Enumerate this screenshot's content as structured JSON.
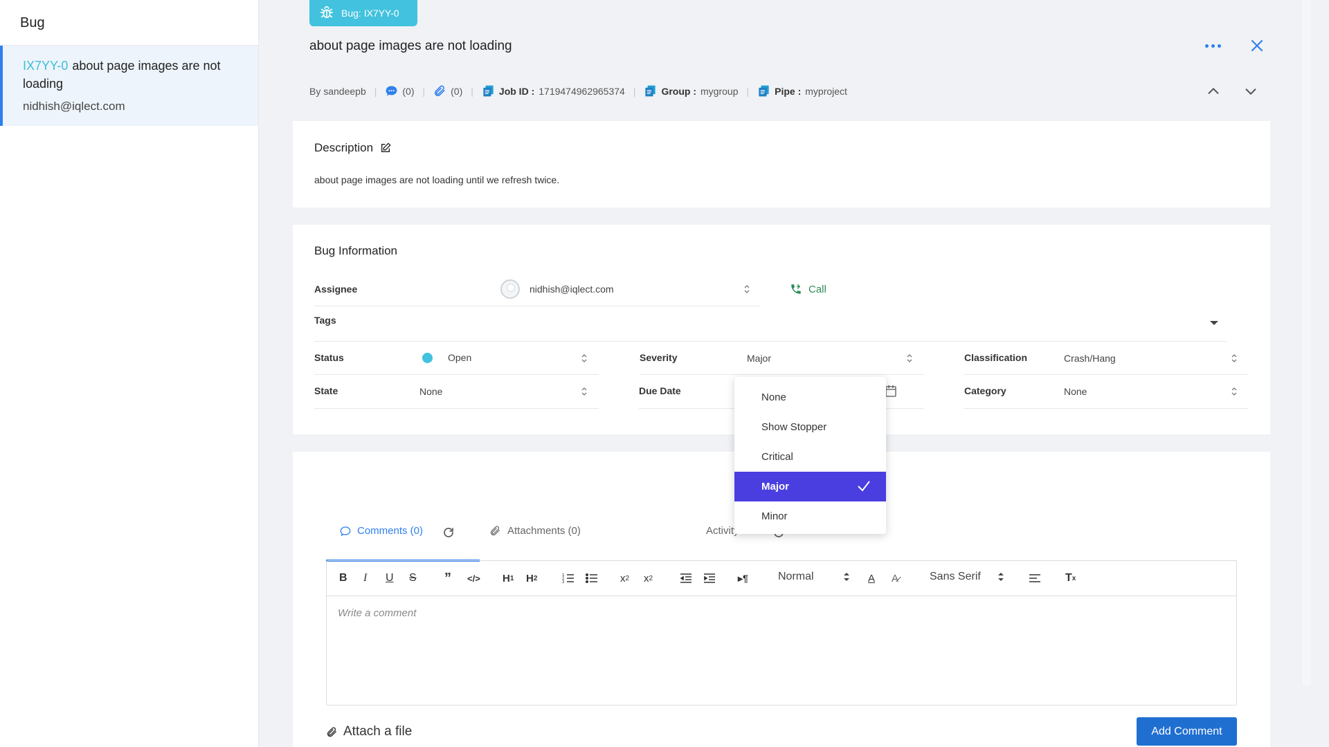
{
  "sidebar": {
    "title": "Bug",
    "item": {
      "code": "IX7YY-0",
      "title": "about page images are not loading",
      "email": "nidhish@iqlect.com"
    }
  },
  "header": {
    "badge": "Bug: IX7YY-0",
    "title": "about page images are not loading",
    "by": "By sandeepb",
    "comments_count": "(0)",
    "attachments_count": "(0)",
    "job_label": "Job ID :",
    "job_value": "1719474962965374",
    "group_label": "Group :",
    "group_value": "mygroup",
    "pipe_label": "Pipe :",
    "pipe_value": "myproject"
  },
  "description": {
    "label": "Description",
    "text": "about page images are not loading until we refresh twice."
  },
  "info": {
    "title": "Bug Information",
    "assignee_label": "Assignee",
    "assignee_value": "nidhish@iqlect.com",
    "call_label": "Call",
    "tags_label": "Tags",
    "status_label": "Status",
    "status_value": "Open",
    "severity_label": "Severity",
    "severity_value": "Major",
    "classification_label": "Classification",
    "classification_value": "Crash/Hang",
    "state_label": "State",
    "state_value": "None",
    "due_label": "Due Date",
    "category_label": "Category",
    "category_value": "None"
  },
  "severity_dropdown": {
    "options": [
      "None",
      "Show Stopper",
      "Critical",
      "Major",
      "Minor"
    ],
    "selected": "Major"
  },
  "tabs": {
    "comments": "Comments (0)",
    "attachments": "Attachments (0)",
    "activity": "Activity S"
  },
  "editor": {
    "format": "Normal",
    "font": "Sans Serif",
    "placeholder": "Write a comment"
  },
  "footer": {
    "attach": "Attach a file",
    "add_comment": "Add Comment"
  },
  "colors": {
    "accent": "#2f80ed",
    "badge": "#42c2de",
    "selected_option": "#4a3ee0",
    "call": "#2e8b57"
  }
}
